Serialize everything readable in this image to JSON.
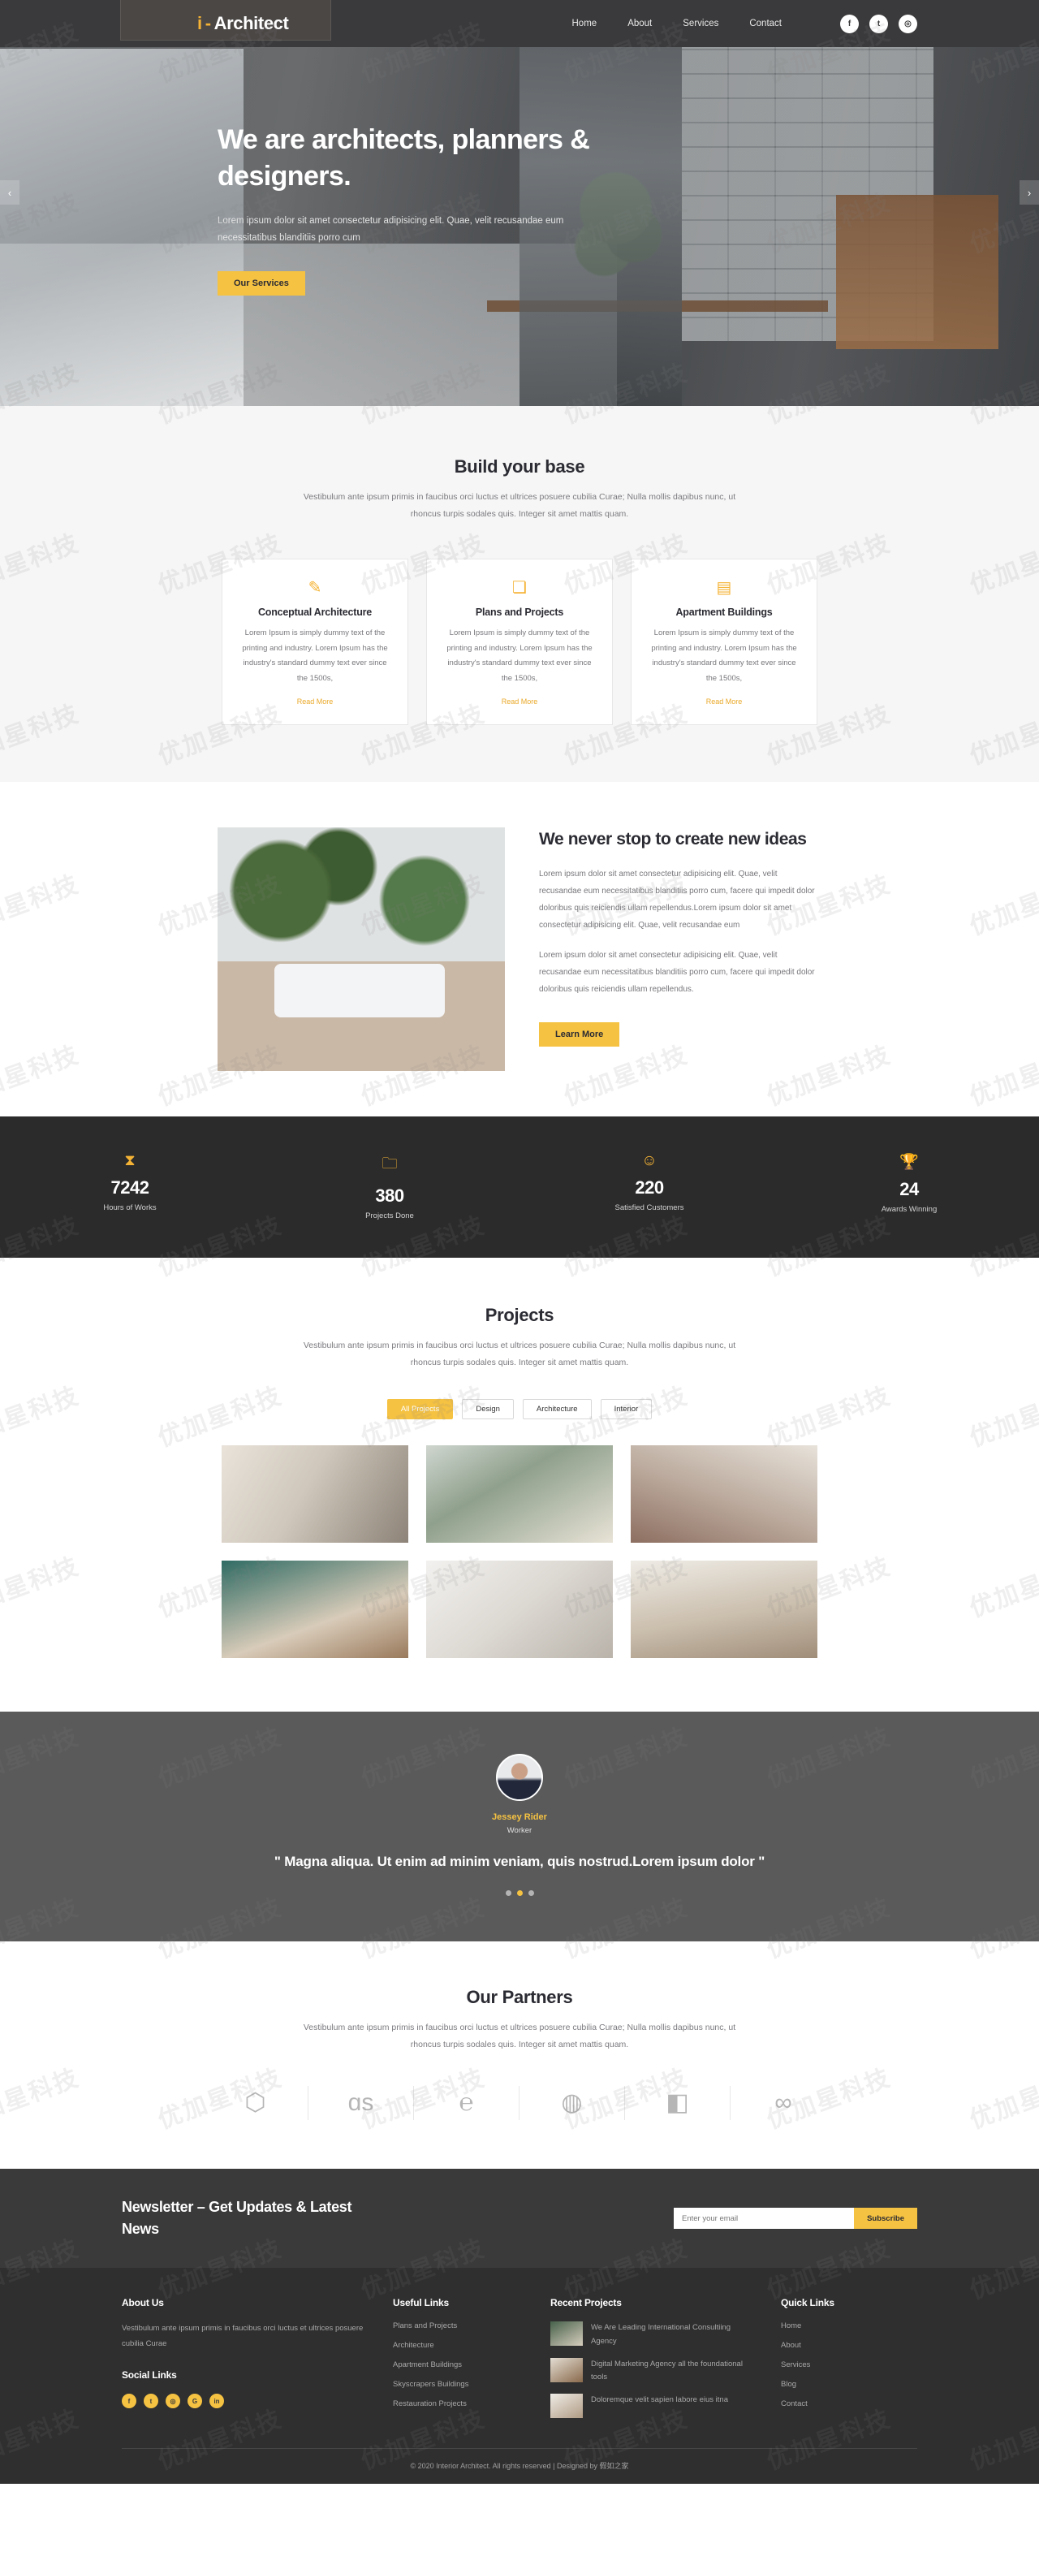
{
  "header": {
    "brand_mark": "i",
    "brand_dash": "-",
    "brand_name": "Architect",
    "nav": [
      {
        "label": "Home"
      },
      {
        "label": "About"
      },
      {
        "label": "Services"
      },
      {
        "label": "Contact"
      }
    ],
    "socials": [
      {
        "name": "facebook-icon",
        "glyph": "f"
      },
      {
        "name": "twitter-icon",
        "glyph": "t"
      },
      {
        "name": "instagram-icon",
        "glyph": "◎"
      }
    ]
  },
  "hero": {
    "title": "We are architects, planners & designers.",
    "paragraph": "Lorem ipsum dolor sit amet consectetur adipisicing elit. Quae, velit recusandae eum necessitatibus blanditiis porro cum",
    "cta": "Our Services",
    "prev": "‹",
    "next": "›"
  },
  "build": {
    "title": "Build your base",
    "subtitle": "Vestibulum ante ipsum primis in faucibus orci luctus et ultrices posuere cubilia Curae; Nulla mollis dapibus nunc, ut rhoncus turpis sodales quis. Integer sit amet mattis quam.",
    "cards": [
      {
        "icon": "paintbrush-icon",
        "glyph": "✎",
        "title": "Conceptual Architecture",
        "text": "Lorem Ipsum is simply dummy text of the printing and industry. Lorem Ipsum has the industry's standard dummy text ever since the 1500s,",
        "link": "Read More"
      },
      {
        "icon": "blueprint-icon",
        "glyph": "❏",
        "title": "Plans and Projects",
        "text": "Lorem Ipsum is simply dummy text of the printing and industry. Lorem Ipsum has the industry's standard dummy text ever since the 1500s,",
        "link": "Read More"
      },
      {
        "icon": "building-icon",
        "glyph": "▤",
        "title": "Apartment Buildings",
        "text": "Lorem Ipsum is simply dummy text of the printing and industry. Lorem Ipsum has the industry's standard dummy text ever since the 1500s,",
        "link": "Read More"
      }
    ]
  },
  "ideas": {
    "title": "We never stop to create new ideas",
    "p1": "Lorem ipsum dolor sit amet consectetur adipisicing elit. Quae, velit recusandae eum necessitatibus blanditiis porro cum, facere qui impedit dolor doloribus quis reiciendis ullam repellendus.Lorem ipsum dolor sit amet consectetur adipisicing elit. Quae, velit recusandae eum",
    "p2": "Lorem ipsum dolor sit amet consectetur adipisicing elit. Quae, velit recusandae eum necessitatibus blanditiis porro cum, facere qui impedit dolor doloribus quis reiciendis ullam repellendus.",
    "cta": "Learn More"
  },
  "counters": [
    {
      "icon": "hourglass-icon",
      "glyph": "⧗",
      "number": "7242",
      "label": "Hours of Works"
    },
    {
      "icon": "folder-icon",
      "glyph": "🗀",
      "number": "380",
      "label": "Projects Done"
    },
    {
      "icon": "smiley-icon",
      "glyph": "☺",
      "number": "220",
      "label": "Satisfied Customers"
    },
    {
      "icon": "trophy-icon",
      "glyph": "🏆",
      "number": "24",
      "label": "Awards Winning"
    }
  ],
  "projects": {
    "title": "Projects",
    "subtitle": "Vestibulum ante ipsum primis in faucibus orci luctus et ultrices posuere cubilia Curae; Nulla mollis dapibus nunc, ut rhoncus turpis sodales quis. Integer sit amet mattis quam.",
    "filters": [
      {
        "label": "All Projects",
        "active": true
      },
      {
        "label": "Design",
        "active": false
      },
      {
        "label": "Architecture",
        "active": false
      },
      {
        "label": "Interior",
        "active": false
      }
    ],
    "items": [
      {
        "name": "project-kitchen"
      },
      {
        "name": "project-living-room"
      },
      {
        "name": "project-lounge"
      },
      {
        "name": "project-bathroom"
      },
      {
        "name": "project-dining"
      },
      {
        "name": "project-kitchen-island"
      }
    ]
  },
  "testimonial": {
    "avatar": "avatar",
    "name": "Jessey Rider",
    "role": "Worker",
    "quote": "\" Magna aliqua. Ut enim ad minim veniam, quis nostrud.Lorem ipsum dolor \"",
    "dots": [
      false,
      true,
      false
    ]
  },
  "partners": {
    "title": "Our Partners",
    "subtitle": "Vestibulum ante ipsum primis in faucibus orci luctus et ultrices posuere cubilia Curae; Nulla mollis dapibus nunc, ut rhoncus turpis sodales quis. Integer sit amet mattis quam.",
    "logos": [
      {
        "name": "cube-logo",
        "glyph": "⬡"
      },
      {
        "name": "lastfm-logo",
        "glyph": "ɑs"
      },
      {
        "name": "c-logo",
        "glyph": "℮"
      },
      {
        "name": "drupal-logo",
        "glyph": "◍"
      },
      {
        "name": "square-logo",
        "glyph": "◧"
      },
      {
        "name": "chain-logo",
        "glyph": "∞"
      }
    ]
  },
  "newsletter": {
    "title": "Newsletter – Get Updates & Latest News",
    "placeholder": "Enter your email",
    "value": "",
    "button": "Subscribe"
  },
  "footer": {
    "about": {
      "title": "About Us",
      "text": "Vestibulum ante ipsum primis in faucibus orci luctus et ultrices posuere cubilia Curae",
      "social_title": "Social Links",
      "socials": [
        {
          "name": "facebook-icon",
          "glyph": "f"
        },
        {
          "name": "twitter-icon",
          "glyph": "t"
        },
        {
          "name": "instagram-icon",
          "glyph": "◎"
        },
        {
          "name": "google-plus-icon",
          "glyph": "G"
        },
        {
          "name": "linkedin-icon",
          "glyph": "in"
        }
      ]
    },
    "useful": {
      "title": "Useful Links",
      "links": [
        {
          "label": "Plans and Projects"
        },
        {
          "label": "Architecture"
        },
        {
          "label": "Apartment Buildings"
        },
        {
          "label": "Skyscrapers Buildings"
        },
        {
          "label": "Restauration Projects"
        }
      ]
    },
    "recent": {
      "title": "Recent Projects",
      "items": [
        {
          "text": "We Are Leading International Consultiing Agency"
        },
        {
          "text": "Digital Marketing Agency all the foundational tools"
        },
        {
          "text": "Doloremque velit sapien labore eius itna"
        }
      ]
    },
    "quick": {
      "title": "Quick Links",
      "links": [
        {
          "label": "Home"
        },
        {
          "label": "About"
        },
        {
          "label": "Services"
        },
        {
          "label": "Blog"
        },
        {
          "label": "Contact"
        }
      ]
    },
    "copyright": "© 2020 Interior Architect. All rights reserved | Designed by 假如之家"
  },
  "watermark": "优加星科技",
  "colors": {
    "accent": "#f5c242",
    "accent_dark": "#eaa92a",
    "dark": "#2b2b2b",
    "footer": "#2f2f2f",
    "testimonial_bg": "#5a5a5a"
  }
}
